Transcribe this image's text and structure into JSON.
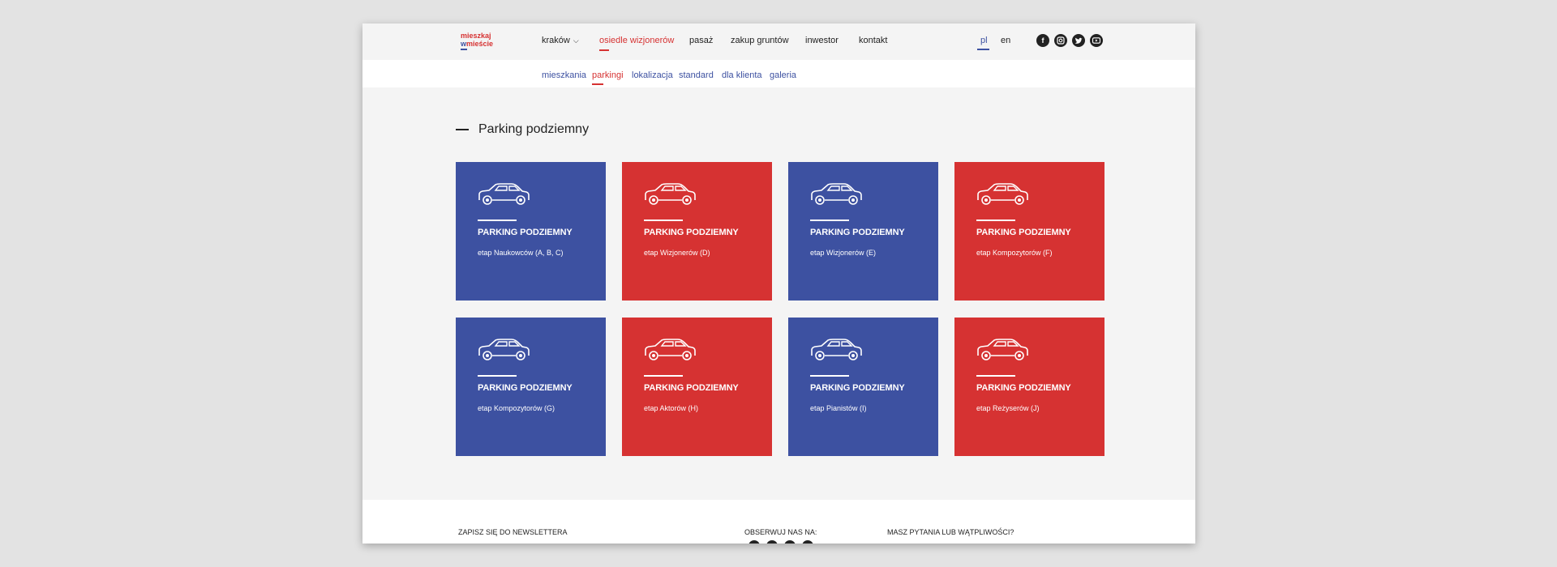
{
  "header": {
    "logo": {
      "line1": "mieszkaj",
      "line2_w": "w",
      "line2_rest": "mieście"
    },
    "nav": [
      {
        "label": "kraków",
        "has_dropdown": true,
        "active": false
      },
      {
        "label": "osiedle wizjonerów",
        "active": true
      },
      {
        "label": "pasaż",
        "active": false
      },
      {
        "label": "zakup gruntów",
        "active": false
      },
      {
        "label": "inwestor",
        "active": false
      },
      {
        "label": "kontakt",
        "active": false
      }
    ],
    "languages": [
      {
        "label": "pl",
        "active": true
      },
      {
        "label": "en",
        "active": false
      }
    ],
    "social_icons": [
      "facebook-icon",
      "instagram-icon",
      "twitter-icon",
      "youtube-icon"
    ]
  },
  "subnav": [
    {
      "label": "mieszkania",
      "active": false
    },
    {
      "label": "parkingi",
      "active": true
    },
    {
      "label": "lokalizacja",
      "active": false
    },
    {
      "label": "standard",
      "active": false
    },
    {
      "label": "dla klienta",
      "active": false
    },
    {
      "label": "galeria",
      "active": false
    }
  ],
  "section": {
    "title": "Parking podziemny"
  },
  "tiles": [
    {
      "title": "PARKING PODZIEMNY",
      "stage": "etap Naukowców (A, B, C)",
      "color": "blue"
    },
    {
      "title": "PARKING PODZIEMNY",
      "stage": "etap Wizjonerów (D)",
      "color": "red"
    },
    {
      "title": "PARKING PODZIEMNY",
      "stage": "etap Wizjonerów (E)",
      "color": "blue"
    },
    {
      "title": "PARKING PODZIEMNY",
      "stage": "etap Kompozytorów (F)",
      "color": "red"
    },
    {
      "title": "PARKING PODZIEMNY",
      "stage": "etap Kompozytorów (G)",
      "color": "blue"
    },
    {
      "title": "PARKING PODZIEMNY",
      "stage": "etap Aktorów (H)",
      "color": "red"
    },
    {
      "title": "PARKING PODZIEMNY",
      "stage": "etap Pianistów (I)",
      "color": "blue"
    },
    {
      "title": "PARKING PODZIEMNY",
      "stage": "etap Reżyserów (J)",
      "color": "red"
    }
  ],
  "footer": {
    "newsletter_title": "ZAPISZ SIĘ DO NEWSLETTERA",
    "follow_title": "OBSERWUJ NAS NA:",
    "questions_title": "MASZ PYTANIA LUB WĄTPLIWOŚCI?"
  },
  "colors": {
    "blue": "#3d51a1",
    "red": "#d63232",
    "background": "#f4f4f4",
    "outer": "#e3e3e3"
  }
}
